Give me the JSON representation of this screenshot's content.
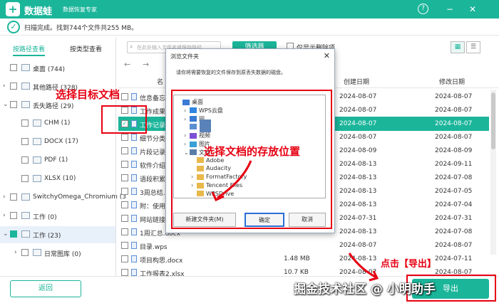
{
  "app": {
    "logo_glyph": "+",
    "title": "数据蛙",
    "subtitle": "数据恢复专家",
    "help": "?",
    "minimize": "−",
    "close": "✕"
  },
  "status": {
    "icon": "check-icon",
    "text": "扫描完成。找到744个文件共255 MB。"
  },
  "left_tabs": {
    "by_path": "按路径查看",
    "by_type": "按类型查看"
  },
  "tree": [
    {
      "label": "桌面 (744)",
      "level": 0,
      "arrow": "",
      "checked": false
    },
    {
      "label": "其他路径 (328)",
      "level": 0,
      "arrow": "›",
      "checked": false
    },
    {
      "label": "丢失路径 (29)",
      "level": 0,
      "arrow": "⌄",
      "checked": false
    },
    {
      "label": "CHM (1)",
      "level": 1,
      "arrow": "",
      "checked": false
    },
    {
      "label": "DOCX (17)",
      "level": 1,
      "arrow": "",
      "checked": false
    },
    {
      "label": "PDF (1)",
      "level": 1,
      "arrow": "",
      "checked": false
    },
    {
      "label": "XLSX (10)",
      "level": 1,
      "arrow": "",
      "checked": false
    },
    {
      "label": "SwitchyOmega_Chromium (3",
      "level": 0,
      "arrow": "›",
      "checked": false
    },
    {
      "label": "工作 (0)",
      "level": 0,
      "arrow": "›",
      "checked": false
    },
    {
      "label": "工作 (23)",
      "level": 0,
      "arrow": "⌄",
      "checked": true
    },
    {
      "label": "日常图库 (0)",
      "level": 1,
      "arrow": "›",
      "checked": false
    }
  ],
  "toolbar": {
    "search_placeholder": "在此处输入文件名或保存路径",
    "filter": "筛选器",
    "show_deleted": "仅显示删除项",
    "view_grid": "▦",
    "view_list": "☰"
  },
  "nav": {
    "back": "←",
    "forward": "→"
  },
  "table": {
    "headers": {
      "name": "名",
      "created": "创建日期",
      "modified": "修改日期"
    },
    "rows": [
      {
        "name": "信息备忘.t",
        "size": "",
        "created": "2024-08-07",
        "modified": "2024-08-07",
        "checked": false,
        "selected": false
      },
      {
        "name": "工作成果分",
        "size": "",
        "created": "2024-08-07",
        "modified": "2024-08-07",
        "checked": false,
        "selected": false
      },
      {
        "name": "工作记录表",
        "size": "",
        "created": "2024-08-07",
        "modified": "2024-08-07",
        "checked": true,
        "selected": true
      },
      {
        "name": "细节分类.d",
        "size": "",
        "created": "2024-08-07",
        "modified": "2024-08-07",
        "checked": false,
        "selected": false
      },
      {
        "name": "片段记录.d",
        "size": "",
        "created": "2024-08-09",
        "modified": "2024-08-09",
        "checked": false,
        "selected": false
      },
      {
        "name": "软件介绍",
        "size": "",
        "created": "2024-08-13",
        "modified": "2024-09-11",
        "checked": false,
        "selected": false
      },
      {
        "name": "语段积累.d",
        "size": "",
        "created": "2024-08-13",
        "modified": "2024-07-08",
        "checked": false,
        "selected": false
      },
      {
        "name": "3周总结.docx",
        "size": "",
        "created": "2024-08-13",
        "modified": "2024-07-05",
        "checked": false,
        "selected": false
      },
      {
        "name": "附：使用注",
        "size": "",
        "created": "2024-08-13",
        "modified": "2024-07-04",
        "checked": false,
        "selected": false
      },
      {
        "name": "网站链接.tx",
        "size": "",
        "created": "2024-07-31",
        "modified": "2024-07-31",
        "checked": false,
        "selected": false
      },
      {
        "name": "1周汇总.docx",
        "size": "",
        "created": "2024-08-13",
        "modified": "2024-07-08",
        "checked": false,
        "selected": false
      },
      {
        "name": "目录.wps",
        "size": "",
        "created": "2024-08-07",
        "modified": "2024-08-07",
        "checked": false,
        "selected": false
      },
      {
        "name": "项目构思.docx",
        "size": "1.48 MB",
        "created": "2024-08-13",
        "modified": "2024-07-11",
        "checked": false,
        "selected": false
      },
      {
        "name": "工作报表2.xlsx",
        "size": "10.7 KB",
        "created": "2024-08-07",
        "modified": "2024-08-07",
        "checked": false,
        "selected": false
      }
    ]
  },
  "dialog": {
    "title": "浏览文件夹",
    "close": "✕",
    "message": "请你将需要恢复的文件保存到原丢失数据的磁盘。",
    "nodes": [
      {
        "label": "桌面",
        "arrow": "",
        "indent": 0,
        "color": "#3a7bd5"
      },
      {
        "label": "WPS云盘",
        "arrow": "›",
        "indent": 1,
        "color": "#2f86e0"
      },
      {
        "label": "网",
        "arrow": "›",
        "indent": 1,
        "color": "#3a7bd5"
      },
      {
        "label": "",
        "arrow": "",
        "indent": 1,
        "color": "#5a8fd0"
      },
      {
        "label": "视频",
        "arrow": "›",
        "indent": 1,
        "color": "#7b4fd6"
      },
      {
        "label": "图片",
        "arrow": "›",
        "indent": 1,
        "color": "#3aa0d5"
      },
      {
        "label": "文档",
        "arrow": "⌄",
        "indent": 1,
        "color": "#5a7da8"
      },
      {
        "label": "Adobe",
        "arrow": "",
        "indent": 2,
        "color": "#e8b84a"
      },
      {
        "label": "Audacity",
        "arrow": "",
        "indent": 2,
        "color": "#e8b84a"
      },
      {
        "label": "FormatFactory",
        "arrow": "›",
        "indent": 2,
        "color": "#e8b84a"
      },
      {
        "label": "Tencent Files",
        "arrow": "›",
        "indent": 2,
        "color": "#e8b84a"
      },
      {
        "label": "WPSDrive",
        "arrow": "",
        "indent": 2,
        "color": "#e8b84a"
      }
    ],
    "new_folder": "新建文件夹(M)",
    "ok": "确定",
    "cancel": "取消"
  },
  "annotations": {
    "select_doc": "选择目标文档",
    "select_location": "选择文档的存放位置",
    "click_export": "点击【导出】"
  },
  "bottom": {
    "back": "返回",
    "export": "导出"
  },
  "watermark": "掘金技术社区 @ 小明助手",
  "colors": {
    "accent": "#1bb59a",
    "annotation": "#e60012"
  }
}
